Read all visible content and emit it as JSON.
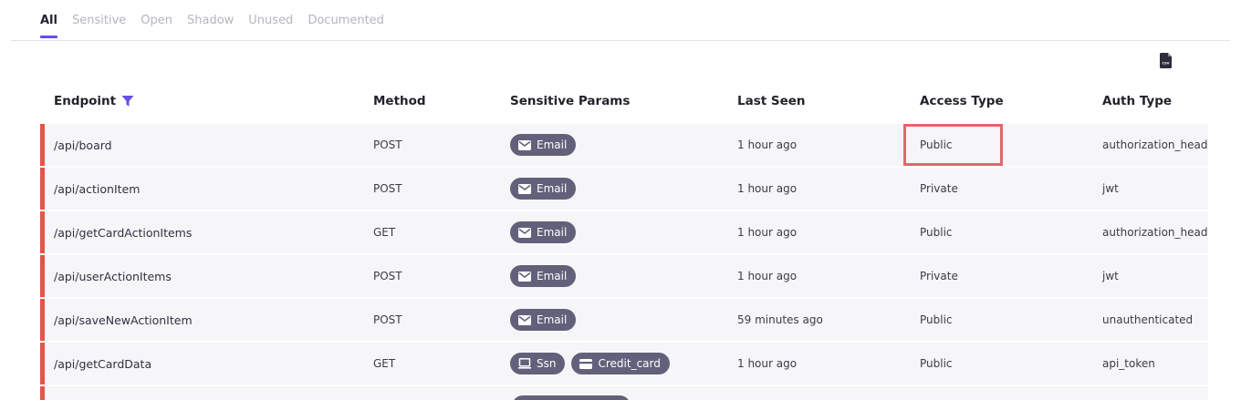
{
  "tabs": [
    {
      "label": "All",
      "active": true
    },
    {
      "label": "Sensitive",
      "active": false
    },
    {
      "label": "Open",
      "active": false
    },
    {
      "label": "Shadow",
      "active": false
    },
    {
      "label": "Unused",
      "active": false
    },
    {
      "label": "Documented",
      "active": false
    }
  ],
  "export": {
    "icon": "csv-file-icon",
    "label": "CSV"
  },
  "columns": {
    "endpoint": "Endpoint",
    "method": "Method",
    "params": "Sensitive Params",
    "seen": "Last Seen",
    "access": "Access Type",
    "auth": "Auth Type"
  },
  "colors": {
    "accent": "#6a4ee8",
    "severity": "#e5534b",
    "tag_bg": "#62607a",
    "highlight": "#e5656c"
  },
  "rows": [
    {
      "endpoint": "/api/board",
      "method": "POST",
      "params": [
        {
          "icon": "email-icon",
          "label": "Email"
        }
      ],
      "seen": "1 hour ago",
      "access": "Public",
      "auth": "authorization_header"
    },
    {
      "endpoint": "/api/actionItem",
      "method": "POST",
      "params": [
        {
          "icon": "email-icon",
          "label": "Email"
        }
      ],
      "seen": "1 hour ago",
      "access": "Private",
      "auth": "jwt"
    },
    {
      "endpoint": "/api/getCardActionItems",
      "method": "GET",
      "params": [
        {
          "icon": "email-icon",
          "label": "Email"
        }
      ],
      "seen": "1 hour ago",
      "access": "Public",
      "auth": "authorization_header"
    },
    {
      "endpoint": "/api/userActionItems",
      "method": "POST",
      "params": [
        {
          "icon": "email-icon",
          "label": "Email"
        }
      ],
      "seen": "1 hour ago",
      "access": "Private",
      "auth": "jwt"
    },
    {
      "endpoint": "/api/saveNewActionItem",
      "method": "POST",
      "params": [
        {
          "icon": "email-icon",
          "label": "Email"
        }
      ],
      "seen": "59 minutes ago",
      "access": "Public",
      "auth": "unauthenticated"
    },
    {
      "endpoint": "/api/getCardData",
      "method": "GET",
      "params": [
        {
          "icon": "ssn-icon",
          "label": "Ssn"
        },
        {
          "icon": "credit-card-icon",
          "label": "Credit_card"
        }
      ],
      "seen": "1 hour ago",
      "access": "Public",
      "auth": "api_token"
    }
  ]
}
